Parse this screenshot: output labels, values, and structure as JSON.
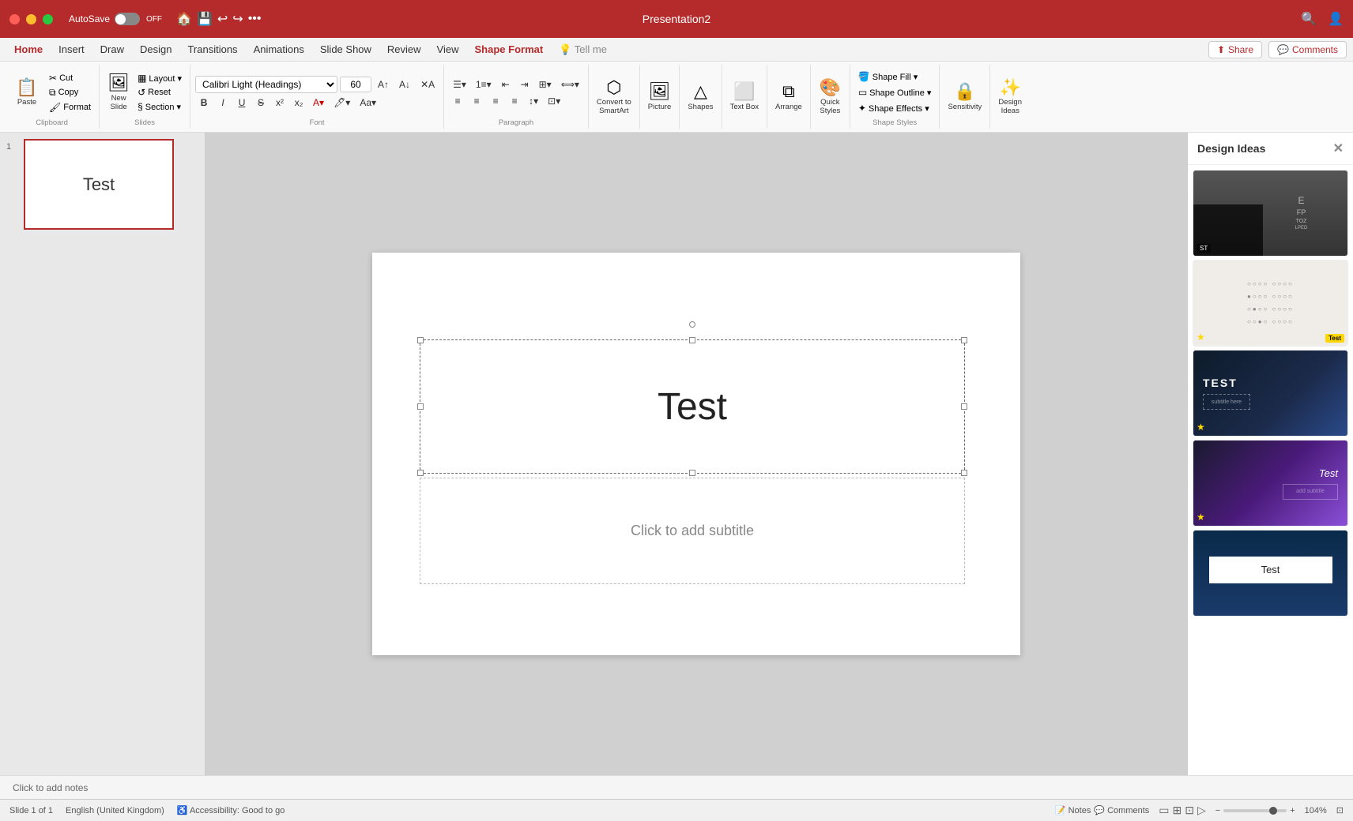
{
  "window": {
    "title": "Presentation2",
    "autosave_label": "AutoSave",
    "autosave_state": "OFF"
  },
  "menu": {
    "items": [
      "Home",
      "Insert",
      "Draw",
      "Design",
      "Transitions",
      "Animations",
      "Slide Show",
      "Review",
      "View"
    ],
    "active": "Home",
    "shape_format": "Shape Format",
    "tell_me": "Tell me",
    "share": "Share",
    "comments": "Comments"
  },
  "ribbon": {
    "groups": {
      "clipboard": {
        "label": "Clipboard",
        "paste": "Paste",
        "cut": "Cut",
        "copy": "Copy",
        "format": "Format"
      },
      "slides": {
        "label": "Slides",
        "new_slide": "New\nSlide",
        "layout": "Layout",
        "reset": "Reset",
        "section": "Section"
      },
      "font": {
        "name": "Calibri Light (Headings)",
        "size": "60",
        "bold": "B",
        "italic": "I",
        "underline": "U",
        "strikethrough": "S"
      },
      "paragraph": "Paragraph",
      "convert_to_smartart": "Convert to\nSmartArt",
      "picture": "Picture",
      "shapes": "Shapes",
      "text_box": "Text Box",
      "arrange": "Arrange",
      "quick_styles": "Quick\nStyles",
      "shape_fill": "Shape Fill",
      "shape_outline": "Shape Outline",
      "sensitivity": "Sensitivity",
      "design_ideas": "Design\nIdeas"
    }
  },
  "slide": {
    "title": "Test",
    "subtitle_placeholder": "Click to add subtitle",
    "slide_number": "1"
  },
  "notes": {
    "placeholder": "Click to add notes"
  },
  "status_bar": {
    "slide_info": "Slide 1 of 1",
    "language": "English (United Kingdom)",
    "accessibility": "Accessibility: Good to go",
    "zoom": "104%",
    "notes": "Notes",
    "comments": "Comments"
  },
  "design_panel": {
    "title": "Design Ideas",
    "cards": [
      {
        "id": "card-1",
        "style": "dark-eye-chart",
        "has_star": false,
        "badge": "ST"
      },
      {
        "id": "card-2",
        "style": "bubble-sheet",
        "has_star": true,
        "badge_text": "Test",
        "badge_color": "yellow"
      },
      {
        "id": "card-3",
        "style": "dark-space-test",
        "text": "TEST",
        "has_star": true
      },
      {
        "id": "card-4",
        "style": "purple-gradient",
        "text": "Test",
        "has_star": true
      },
      {
        "id": "card-5",
        "style": "dark-blue",
        "text": "Test",
        "has_star": false
      }
    ]
  }
}
